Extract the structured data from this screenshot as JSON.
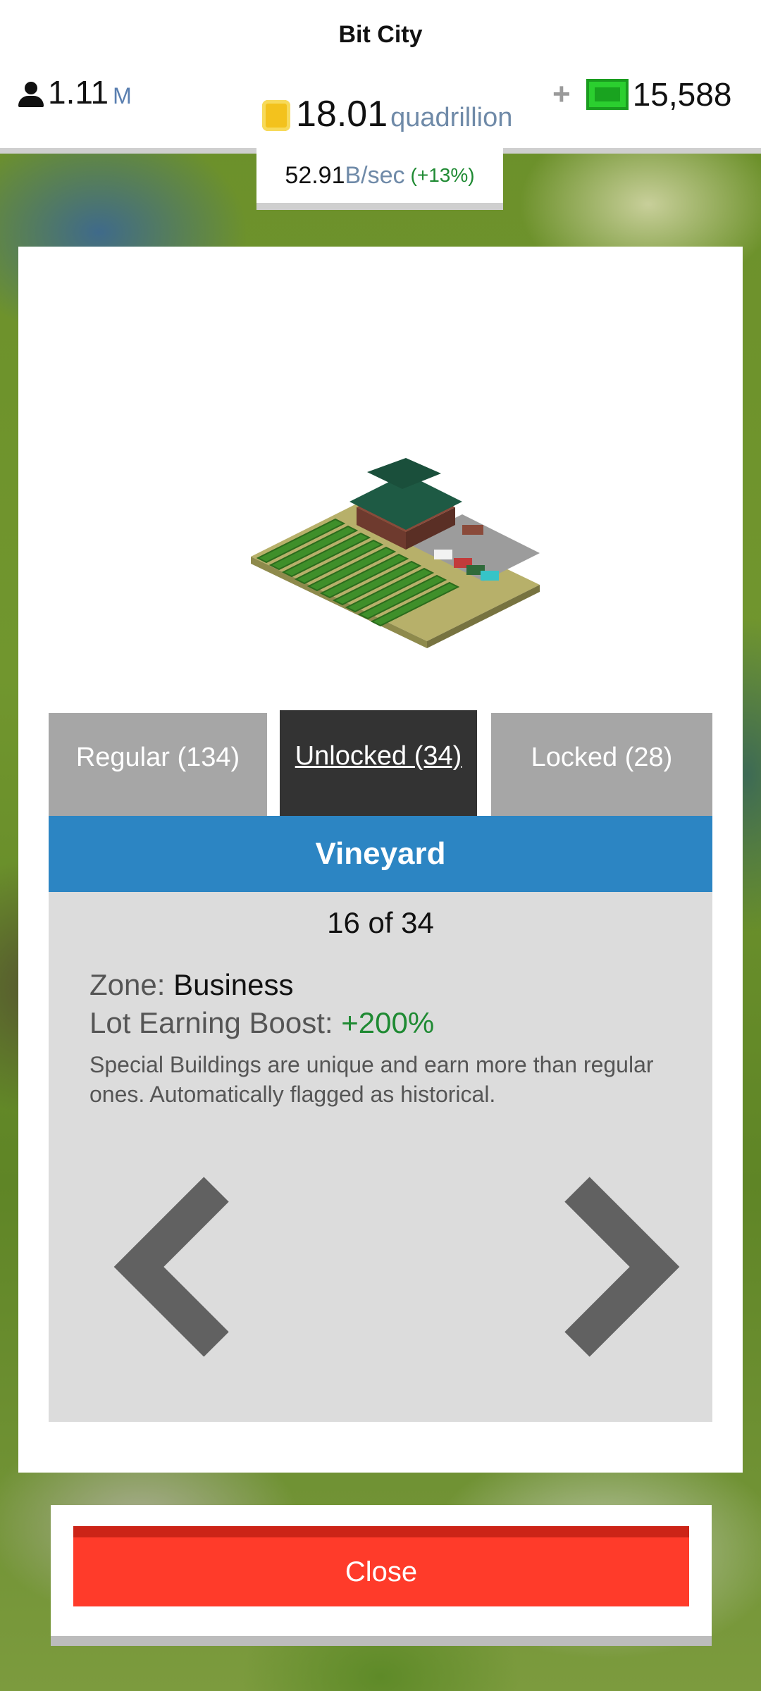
{
  "header": {
    "city_name": "Bit City",
    "population_value": "1.11",
    "population_unit": "M",
    "money_value": "18.01",
    "money_unit": "quadrillion",
    "cash_value": "15,588",
    "rate_value": "52.91",
    "rate_unit": "B/sec",
    "rate_boost": "(+13%)"
  },
  "tabs": [
    {
      "label": "Regular (134)",
      "active": false
    },
    {
      "label": "Unlocked (34)",
      "active": true
    },
    {
      "label": "Locked (28)",
      "active": false
    }
  ],
  "building": {
    "name": "Vineyard",
    "counter": "16 of 34",
    "zone_label": "Zone:",
    "zone_value": "Business",
    "boost_label": "Lot Earning Boost:",
    "boost_value": "+200%",
    "description": "Special Buildings are unique and earn more than regular ones. Automatically flagged as historical."
  },
  "close_label": "Close",
  "colors": {
    "accent_blue": "#2c85c3",
    "close_red": "#ff3b2a",
    "boost_green": "#1f8a33"
  }
}
